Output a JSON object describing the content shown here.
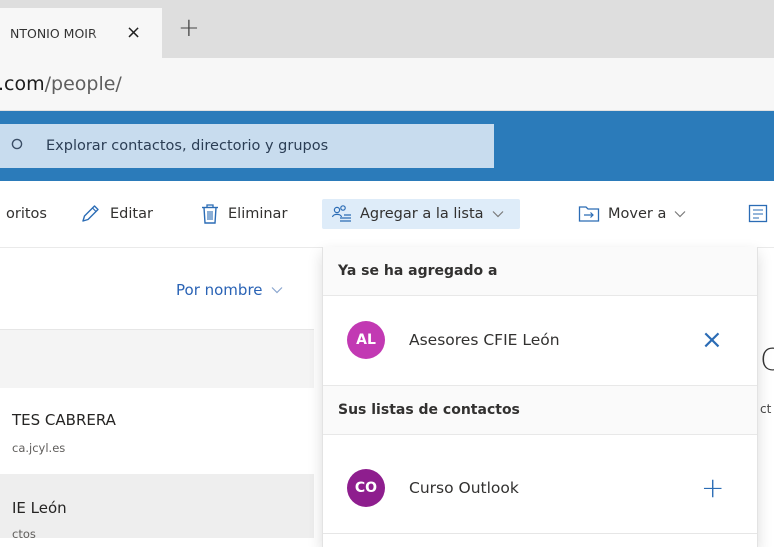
{
  "browser": {
    "tab_title": "NTONIO MOIR",
    "tab_close": "×",
    "new_tab": "+",
    "url_host": ".com",
    "url_path": "/people/"
  },
  "search": {
    "placeholder": "Explorar contactos, directorio y grupos"
  },
  "commands": {
    "favorites": "oritos",
    "edit": "Editar",
    "delete": "Eliminar",
    "add_to_list": "Agregar a la lista",
    "move_to": "Mover a"
  },
  "list": {
    "sort_label": "Por nombre",
    "rows": [
      {
        "name": "TES CABRERA",
        "sub": "ca.jcyl.es"
      },
      {
        "name": "IE León",
        "sub": "ctos"
      }
    ]
  },
  "dropdown": {
    "added_heading": "Ya se ha agregado a",
    "added": [
      {
        "initials": "AL",
        "label": "Asesores CFIE León",
        "action": "×",
        "color": "#c239b3"
      }
    ],
    "lists_heading": "Sus listas de contactos",
    "lists": [
      {
        "initials": "CO",
        "label": "Curso Outlook",
        "action": "+",
        "color": "#8e1e8e"
      }
    ]
  },
  "edge": {
    "letter": "C",
    "text": "ct"
  },
  "colors": {
    "header_blue": "#2b7bba",
    "link_blue": "#2a63b5",
    "icon_blue": "#2b6cb5"
  }
}
